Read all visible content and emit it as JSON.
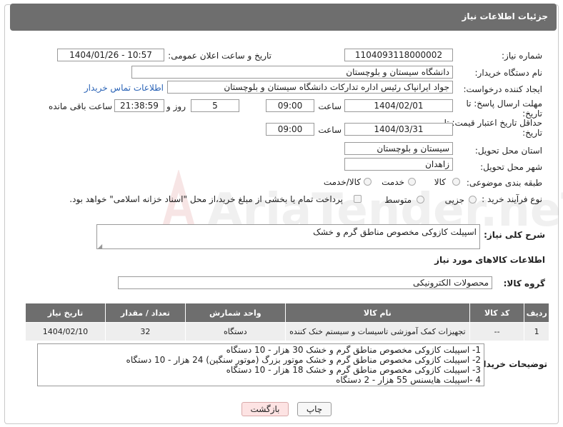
{
  "header": {
    "title": "جزئیات اطلاعات نیاز"
  },
  "fields": {
    "need_number_label": "شماره نیاز:",
    "need_number": "1104093118000002",
    "announce_label": "تاریخ و ساعت اعلان عمومی:",
    "announce_value": "1404/01/26 - 10:57",
    "buyer_org_label": "نام دستگاه خریدار:",
    "buyer_org": "دانشگاه سیستان و بلوچستان",
    "creator_label": "ایجاد کننده درخواست:",
    "creator": "جواد ایرانپاک رئیس اداره تدارکات دانشگاه سیستان و بلوچستان",
    "contact_link": "اطلاعات تماس خریدار",
    "deadline_label": "مهلت ارسال پاسخ: تا تاریخ:",
    "deadline_date": "1404/02/01",
    "time_label": "ساعت",
    "deadline_time": "09:00",
    "days_value": "5",
    "days_label": "روز و",
    "remaining_time": "21:38:59",
    "remaining_label": "ساعت باقی مانده",
    "validity_label": "حداقل تاریخ اعتبار قیمت: تا تاریخ:",
    "validity_date": "1404/03/31",
    "validity_time": "09:00",
    "province_label": "استان محل تحویل:",
    "province": "سیستان و بلوچستان",
    "city_label": "شهر محل تحویل:",
    "city": "زاهدان",
    "category_label": "طبقه بندی موضوعی:",
    "category_options": [
      "کالا",
      "خدمت",
      "کالا/خدمت"
    ],
    "process_label": "نوع فرآیند خرید :",
    "process_options": [
      "جزیی",
      "متوسط"
    ],
    "payment_note": "پرداخت تمام یا بخشی از مبلغ خرید،از محل \"اسناد خزانه اسلامی\" خواهد بود.",
    "description_label": "شرح کلی نیاز:",
    "description": "اسپیلت کازوکی مخصوص مناطق گرم و خشک",
    "goods_info_title": "اطلاعات کالاهای مورد نیاز",
    "goods_group_label": "گروه کالا:",
    "goods_group": "محصولات الکترونیکی"
  },
  "table": {
    "headers": [
      "ردیف",
      "کد کالا",
      "نام کالا",
      "واحد شمارش",
      "تعداد / مقدار",
      "تاریخ نیاز"
    ],
    "rows": [
      [
        "1",
        "--",
        "تجهیزات کمک آموزشی تاسیسات و سیستم خنک کننده",
        "دستگاه",
        "32",
        "1404/02/10"
      ]
    ]
  },
  "buyer_notes": {
    "label": "توضیحات خریدار:",
    "lines": [
      "1- اسپیلت کازوکی مخصوص مناطق گرم و خشک 30 هزار - 10 دستگاه",
      "2- اسپیلت کازوکی مخصوص مناطق گرم و خشک موتور بزرگ (موتور سنگین) 24 هزار - 10 دستگاه",
      "3- اسپیلت کازوکی مخصوص مناطق گرم و خشک 18 هزار - 10 دستگاه",
      "4 -اسپیلت هایسنس 55 هزار - 2 دستگاه"
    ]
  },
  "buttons": {
    "print": "چاپ",
    "back": "بازگشت"
  },
  "watermark": "AriaTender.neT",
  "colors": {
    "header_bg": "#6e6e6e",
    "link": "#2a63b6",
    "back_button_bg": "#fde3e3"
  }
}
